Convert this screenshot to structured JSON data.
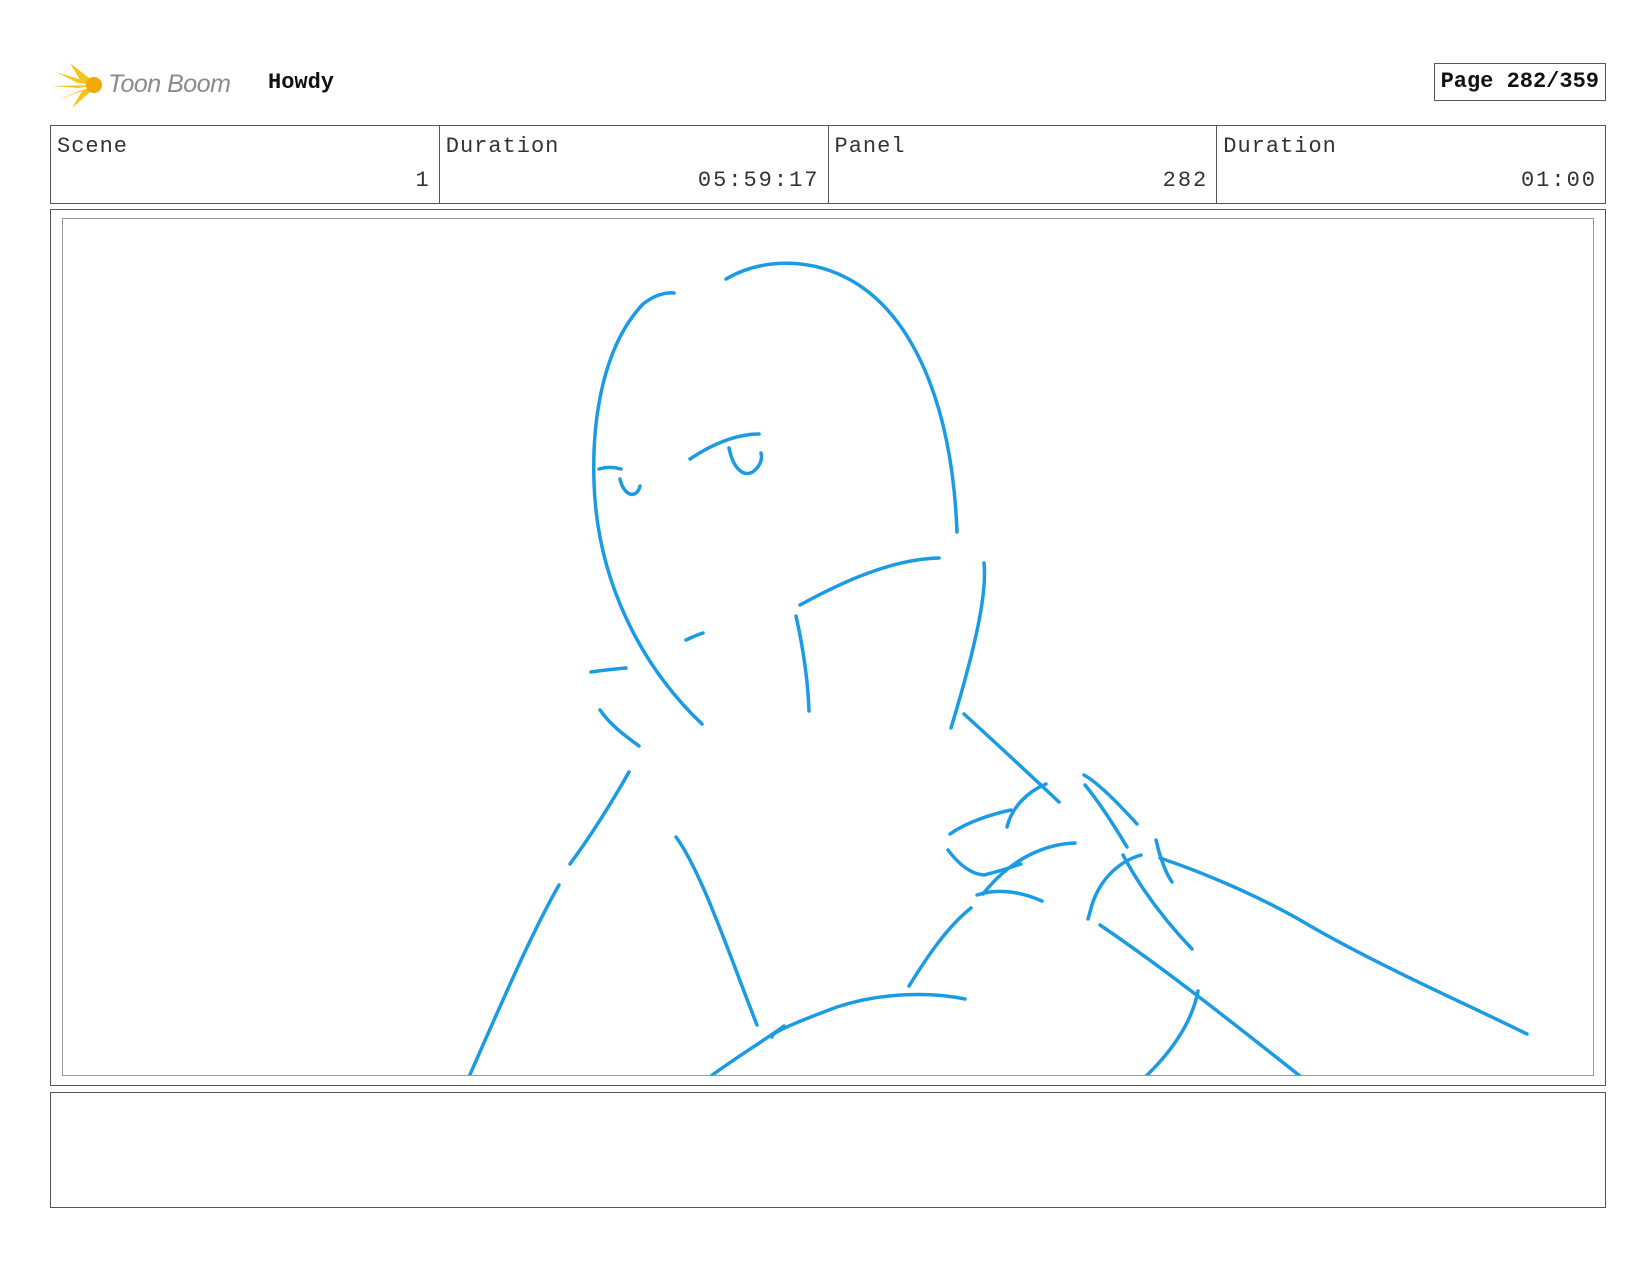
{
  "header": {
    "logo_text": "Toon Boom",
    "project_title": "Howdy",
    "page_label": "Page 282/359"
  },
  "info": {
    "scene_label": "Scene",
    "scene_value": "1",
    "scene_duration_label": "Duration",
    "scene_duration_value": "05:59:17",
    "panel_label": "Panel",
    "panel_value": "282",
    "panel_duration_label": "Duration",
    "panel_duration_value": "01:00"
  },
  "sketch": {
    "stroke_color": "#1a9be3",
    "logo_color": "#f5c518"
  },
  "notes": {
    "text": ""
  }
}
